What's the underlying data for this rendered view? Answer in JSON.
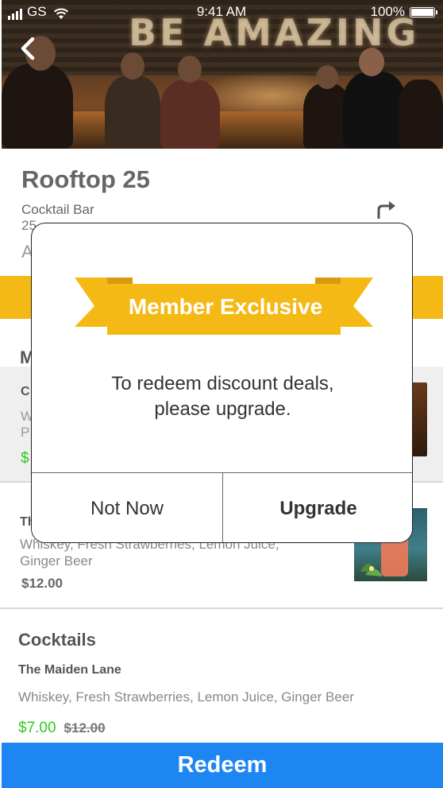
{
  "status_bar": {
    "carrier": "GS",
    "time": "9:41 AM",
    "battery": "100%"
  },
  "hero": {
    "sign_text": "BE AMAZING"
  },
  "venue": {
    "name": "Rooftop 25",
    "type": "Cocktail Bar",
    "address_partial": "25",
    "distance_partial": "A"
  },
  "menu": {
    "heading_partial": "M",
    "item1": {
      "name_partial": "C",
      "desc_partial_1": "W",
      "desc_partial_2": "P",
      "price_partial": "$"
    },
    "item2": {
      "name_partial": "Th",
      "description": "Whiskey, Fresh Strawberries, Lemon Juice, Ginger Beer",
      "price": "$12.00"
    }
  },
  "cocktails": {
    "title": "Cocktails",
    "item": {
      "name": "The Maiden Lane",
      "description": "Whiskey, Fresh Strawberries, Lemon Juice, Ginger Beer",
      "deal_price": "$7.00",
      "original_price": "$12.00"
    }
  },
  "redeem_button": "Redeem",
  "modal": {
    "ribbon_label": "Member Exclusive",
    "message_line1": "To redeem discount deals,",
    "message_line2": "please upgrade.",
    "secondary_button": "Not Now",
    "primary_button": "Upgrade"
  },
  "colors": {
    "accent_yellow": "#f5b915",
    "ribbon_dark": "#d99a10",
    "redeem_blue": "#1e86f3",
    "deal_green": "#2ecc1a"
  },
  "icons": {
    "back": "chevron-left-icon",
    "directions": "turn-right-arrow-icon",
    "wifi": "wifi-icon",
    "battery": "battery-icon",
    "signal": "signal-icon"
  }
}
